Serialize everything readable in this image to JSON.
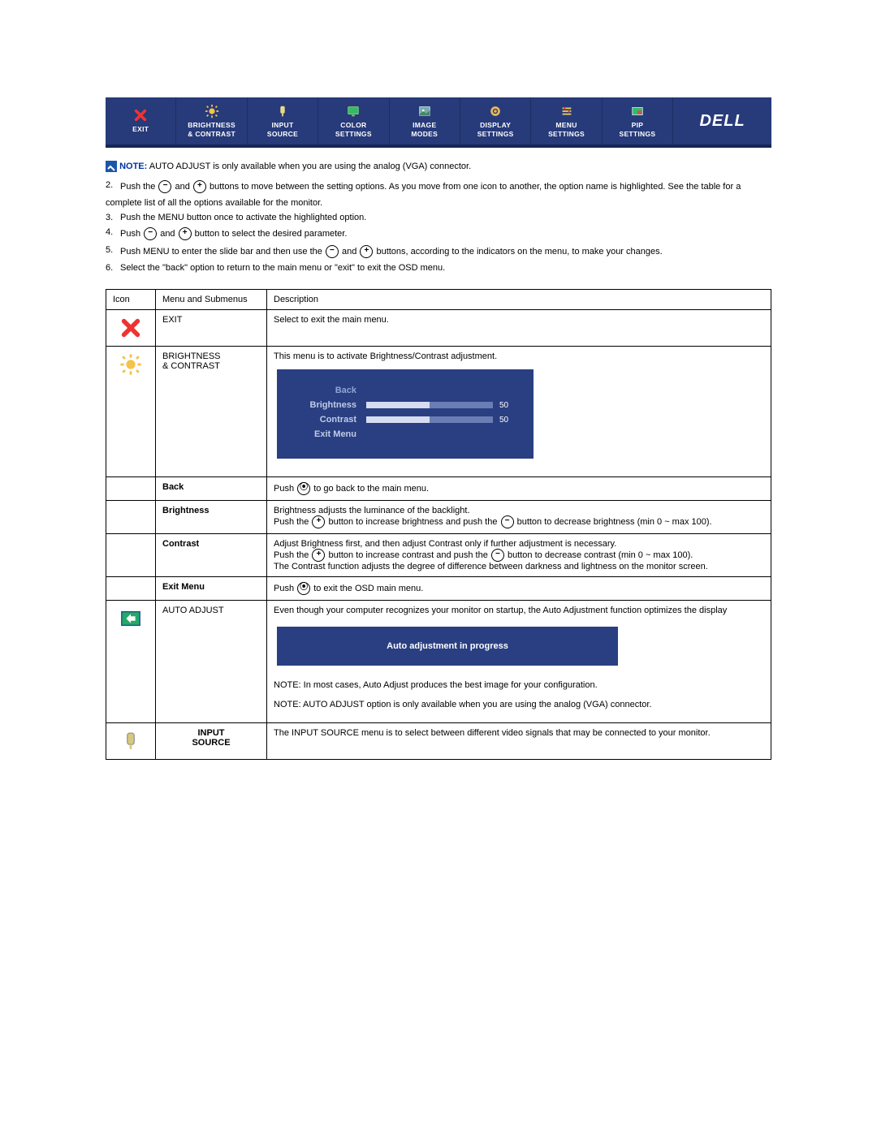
{
  "osd_bar": {
    "items": [
      {
        "label": "EXIT",
        "label2": "",
        "icon": "exit"
      },
      {
        "label": "BRIGHTNESS",
        "label2": "& CONTRAST",
        "icon": "brightness"
      },
      {
        "label": "INPUT",
        "label2": "SOURCE",
        "icon": "input"
      },
      {
        "label": "COLOR",
        "label2": "SETTINGS",
        "icon": "color"
      },
      {
        "label": "IMAGE",
        "label2": "MODES",
        "icon": "image"
      },
      {
        "label": "DISPLAY",
        "label2": "SETTINGS",
        "icon": "display"
      },
      {
        "label": "MENU",
        "label2": "SETTINGS",
        "icon": "menu"
      },
      {
        "label": "PIP",
        "label2": "SETTINGS",
        "icon": "pip"
      }
    ],
    "logo": "DELL"
  },
  "intro": {
    "note_label": "NOTE:",
    "note_text": " AUTO ADJUST is only available when you are using the analog (VGA) connector.",
    "step2a": "Push the ",
    "step2b": " and ",
    "step2c": " buttons to move between the setting options. As you move from one icon to another, the option name is highlighted. See the table for a",
    "step2d": "complete list of all the options available for the monitor.",
    "step3": "Push the MENU button once to activate the highlighted option.",
    "step4a": "Push ",
    "step4b": " and ",
    "step4c": " button to select the desired parameter.",
    "step5a": "Push MENU to enter the slide bar and then use the  ",
    "step5b": " and ",
    "step5c": " buttons, according to the indicators on the menu, to make your changes.",
    "step6": "Select the \"back\" option to return to the main menu or \"exit\" to exit the OSD menu.",
    "n2": "2.",
    "n3": "3.",
    "n4": "4.",
    "n5": "5.",
    "n6": "6."
  },
  "table": {
    "head": {
      "icon": "Icon",
      "menu": "Menu and Submenus",
      "desc": "Description"
    },
    "rows": {
      "exit": {
        "menu": "EXIT",
        "desc": "Select to exit the main menu."
      },
      "bright": {
        "menu1": "BRIGHTNESS",
        "menu2": "& CONTRAST",
        "desc": "This menu is to activate Brightness/Contrast adjustment.",
        "panel": {
          "back": "Back",
          "brightness": "Brightness",
          "contrast": "Contrast",
          "exitmenu": "Exit Menu",
          "b_val": "50",
          "c_val": "50"
        },
        "sub": {
          "back_lbl": "Back",
          "back_txt": "Push ",
          "back_txt2": " to go back to the main menu.",
          "brightness_lbl": "Brightness",
          "brightness_txt1": "Brightness adjusts the luminance of the backlight.",
          "brightness_txt2a": "Push the ",
          "brightness_txt2b": " button to increase brightness and push the ",
          "brightness_txt2c": " button to decrease brightness (min 0 ~ max 100).",
          "contrast_lbl": "Contrast",
          "contrast_txt1": "Adjust Brightness first, and then adjust Contrast only if further adjustment is necessary.",
          "contrast_txt2a": "Push the ",
          "contrast_txt2b": " button to increase contrast and push the ",
          "contrast_txt2c": " button to decrease contrast (min 0 ~ max 100).",
          "contrast_txt3": "The Contrast function adjusts the degree of difference between darkness and lightness on the monitor screen.",
          "exitmenu_lbl": "Exit Menu",
          "exitmenu_txt1": "Push ",
          "exitmenu_txt2": " to exit the OSD main menu."
        }
      },
      "auto": {
        "menu": "AUTO ADJUST",
        "desc": "Even though your computer recognizes your monitor on startup, the Auto Adjustment function optimizes the display",
        "banner": "Auto adjustment in progress",
        "note1": "NOTE: In most cases, Auto Adjust produces the best image for your configuration.",
        "note2": "NOTE: AUTO ADJUST option is only available when you are using the analog (VGA) connector."
      },
      "input": {
        "menu1": "INPUT",
        "menu2": "SOURCE",
        "desc": "The INPUT SOURCE menu is to select between different video signals that may be connected to your monitor."
      }
    }
  }
}
